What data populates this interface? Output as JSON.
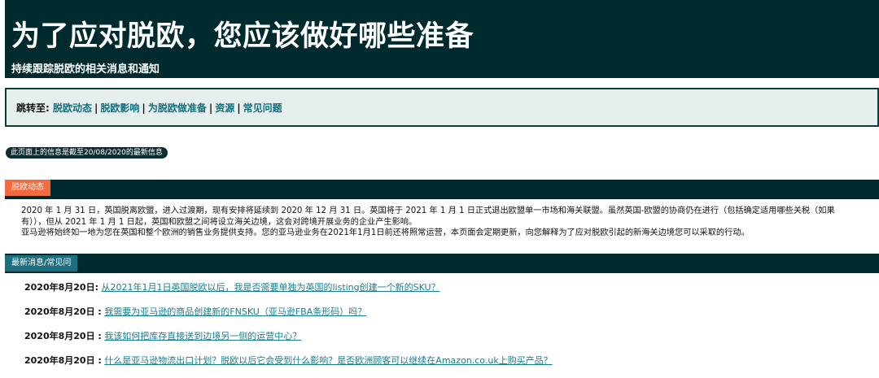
{
  "hero": {
    "title": "为了应对脱欧，您应该做好哪些准备",
    "subtitle": "持续跟踪脱欧的相关消息和通知"
  },
  "jump_nav": {
    "label": "跳转至:",
    "separator": "|",
    "links": [
      "脱欧动态",
      "脱欧影响",
      "为脱欧做准备",
      "资源",
      "常见问题"
    ]
  },
  "update_notice": "此页面上的信息是截至20/08/2020的最新信息",
  "brexit_section": {
    "tab_label": "脱欧动态",
    "paragraph1": "2020 年 1 月 31 日，英国脱离欧盟，进入过渡期，现有安排将延续到 2020 年 12 月 31 日。英国将于 2021 年 1 月 1 日正式退出欧盟单一市场和海关联盟。虽然英国-欧盟的协商仍在进行（包括确定适用哪些关税（如果有）），但从 2021 年 1 月 1 日起，英国和欧盟之间将设立海关边境，这会对跨境开展业务的企业产生影响。",
    "paragraph2": "亚马逊将始终如一地为您在英国和整个欧洲的销售业务提供支持。您的亚马逊业务在2021年1月1日前还将照常运营，本页面会定期更新，向您解释为了应对脱欧引起的新海关边境您可以采取的行动。"
  },
  "faq_section": {
    "tab_label": "最新消息/常见问",
    "items": [
      {
        "date": "2020年8月20日:",
        "question": "从2021年1月1日英国脱欧以后，我是否需要单独为英国的listing创建一个新的SKU？"
      },
      {
        "date": "2020年8月20日 :",
        "question": "我需要为亚马逊的商品创建新的FNSKU（亚马逊FBA条形码）吗？"
      },
      {
        "date": "2020年8月20日 :",
        "question": "我该如何把库存直接送到边境另一侧的运营中心？"
      },
      {
        "date": "2020年8月20日 :",
        "question": "什么是亚马逊物流出口计划？脱欧以后它会受到什么影响？是否欧洲顾客可以继续在Amazon.co.uk上购买产品？"
      }
    ]
  },
  "colors": {
    "hero_bg": "#002b2e",
    "jump_bg": "#e6eeee",
    "link": "#177d8c",
    "tab_orange": "#f26a3f",
    "tab_teal": "#1d6f7f"
  }
}
